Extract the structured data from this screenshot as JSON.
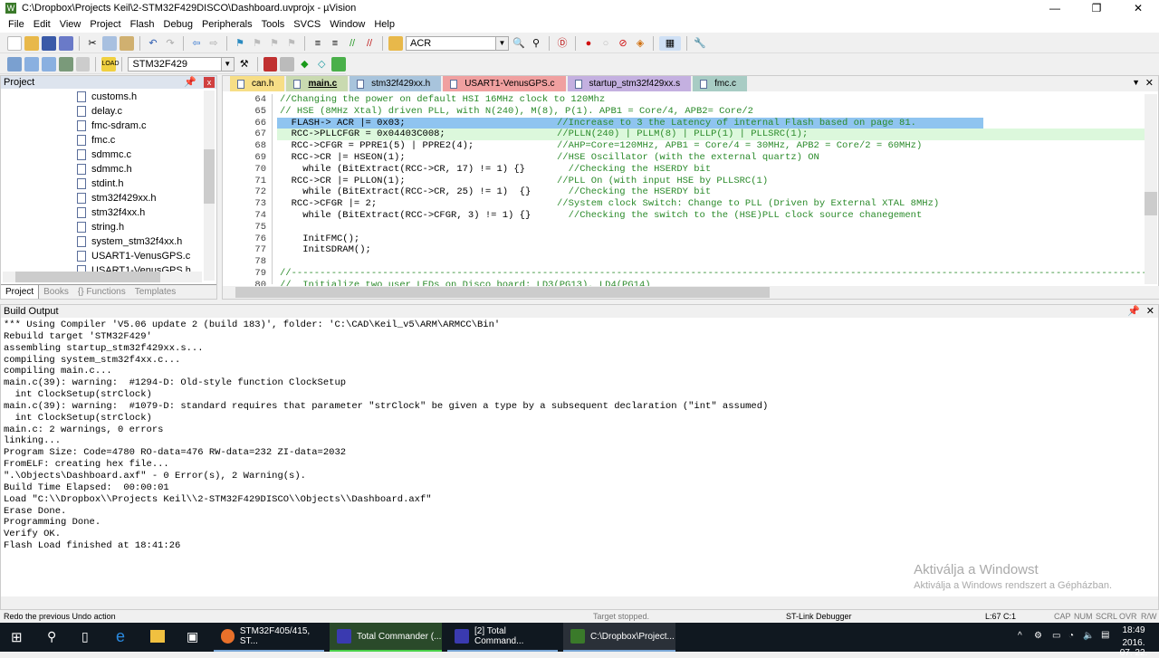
{
  "window": {
    "title": "C:\\Dropbox\\Projects Keil\\2-STM32F429DISCO\\Dashboard.uvprojx - µVision",
    "minimize": "—",
    "maximize": "❐",
    "close": "✕"
  },
  "menu": [
    "File",
    "Edit",
    "View",
    "Project",
    "Flash",
    "Debug",
    "Peripherals",
    "Tools",
    "SVCS",
    "Window",
    "Help"
  ],
  "toolbar": {
    "find_value": "ACR",
    "target_value": "STM32F429"
  },
  "project_panel": {
    "title": "Project",
    "files": [
      "customs.h",
      "delay.c",
      "fmc-sdram.c",
      "fmc.c",
      "sdmmc.c",
      "sdmmc.h",
      "stdint.h",
      "stm32f429xx.h",
      "stm32f4xx.h",
      "string.h",
      "system_stm32f4xx.h",
      "USART1-VenusGPS.c",
      "USART1-VenusGPS.h"
    ],
    "tabs": [
      "Project",
      "Books",
      "{} Functions",
      "Templates"
    ]
  },
  "editor": {
    "tabs": [
      {
        "label": "can.h",
        "color": "#f7de86"
      },
      {
        "label": "main.c",
        "color": "#c9dab0"
      },
      {
        "label": "stm32f429xx.h",
        "color": "#a8c4dc"
      },
      {
        "label": "USART1-VenusGPS.c",
        "color": "#f0a0a0"
      },
      {
        "label": "startup_stm32f429xx.s",
        "color": "#c4b0e0"
      },
      {
        "label": "fmc.c",
        "color": "#a8ccc4"
      }
    ],
    "lines": [
      {
        "n": "64",
        "code": "//Changing the power on default HSI 16MHz clock to 120Mhz",
        "comment": ""
      },
      {
        "n": "65",
        "code": "// HSE (8MHz Xtal) driven PLL, with N(240), M(8), P(1). APB1 = Core/4, APB2= Core/2",
        "comment": ""
      },
      {
        "n": "66",
        "code": "  FLASH-> ACR |= 0x03;",
        "comment": "//Increase to 3 the Latency of internal Flash based on page 81."
      },
      {
        "n": "67",
        "code": "  RCC->PLLCFGR = 0x04403C008;",
        "comment": "//PLLN(240) | PLLM(8) | PLLP(1) | PLLSRC(1);"
      },
      {
        "n": "68",
        "code": "  RCC->CFGR = PPRE1(5) | PPRE2(4);",
        "comment": "//AHP=Core=120MHz, APB1 = Core/4 = 30MHz, APB2 = Core/2 = 60MHz)"
      },
      {
        "n": "69",
        "code": "  RCC->CR |= HSEON(1);",
        "comment": "//HSE Oscillator (with the external quartz) ON"
      },
      {
        "n": "70",
        "code": "    while (BitExtract(RCC->CR, 17) != 1) {}",
        "comment": "  //Checking the HSERDY bit"
      },
      {
        "n": "71",
        "code": "  RCC->CR |= PLLON(1);",
        "comment": "//PLL On (with input HSE by PLLSRC(1)"
      },
      {
        "n": "72",
        "code": "    while (BitExtract(RCC->CR, 25) != 1)  {}",
        "comment": "  //Checking the HSERDY bit"
      },
      {
        "n": "73",
        "code": "  RCC->CFGR |= 2;",
        "comment": "//System clock Switch: Change to PLL (Driven by External XTAL 8MHz)"
      },
      {
        "n": "74",
        "code": "    while (BitExtract(RCC->CFGR, 3) != 1) {}",
        "comment": "  //Checking the switch to the (HSE)PLL clock source chanegement"
      },
      {
        "n": "75",
        "code": "",
        "comment": ""
      },
      {
        "n": "76",
        "code": "    InitFMC();",
        "comment": ""
      },
      {
        "n": "77",
        "code": "    InitSDRAM();",
        "comment": ""
      },
      {
        "n": "78",
        "code": "",
        "comment": ""
      },
      {
        "n": "79",
        "code": "//------------------------------------------------------------------------------------------------------------------------------------------------------------",
        "comment": ""
      },
      {
        "n": "80",
        "code": "//  Initialize two user LEDs on Disco board: LD3(PG13), LD4(PG14)",
        "comment": ""
      }
    ]
  },
  "build_output": {
    "title": "Build Output",
    "lines": [
      "*** Using Compiler 'V5.06 update 2 (build 183)', folder: 'C:\\CAD\\Keil_v5\\ARM\\ARMCC\\Bin'",
      "Rebuild target 'STM32F429'",
      "assembling startup_stm32f429xx.s...",
      "compiling system_stm32f4xx.c...",
      "compiling main.c...",
      "main.c(39): warning:  #1294-D: Old-style function ClockSetup",
      "  int ClockSetup(strClock)",
      "main.c(39): warning:  #1079-D: standard requires that parameter \"strClock\" be given a type by a subsequent declaration (\"int\" assumed)",
      "  int ClockSetup(strClock)",
      "main.c: 2 warnings, 0 errors",
      "linking...",
      "Program Size: Code=4780 RO-data=476 RW-data=232 ZI-data=2032",
      "FromELF: creating hex file...",
      "\".\\Objects\\Dashboard.axf\" - 0 Error(s), 2 Warning(s).",
      "Build Time Elapsed:  00:00:01",
      "Load \"C:\\\\Dropbox\\\\Projects Keil\\\\2-STM32F429DISCO\\\\Objects\\\\Dashboard.axf\"",
      "Erase Done.",
      "Programming Done.",
      "Verify OK.",
      "Flash Load finished at 18:41:26"
    ]
  },
  "watermark": {
    "title": "Aktiválja a Windowst",
    "subtitle": "Aktiválja a Windows rendszert a Gépházban."
  },
  "status": {
    "hint": "Redo the previous Undo action",
    "target": "Target stopped.",
    "debugger": "ST-Link Debugger",
    "position": "L:67 C:1",
    "indicators": [
      "CAP",
      "NUM",
      "SCRL",
      "OVR",
      "R/W"
    ]
  },
  "taskbar": {
    "tasks": [
      "STM32F405/415, ST...",
      "Total Commander (...",
      "[2] Total Command...",
      "C:\\Dropbox\\Project..."
    ],
    "time": "18:49",
    "date": "2016. 07. 22."
  }
}
